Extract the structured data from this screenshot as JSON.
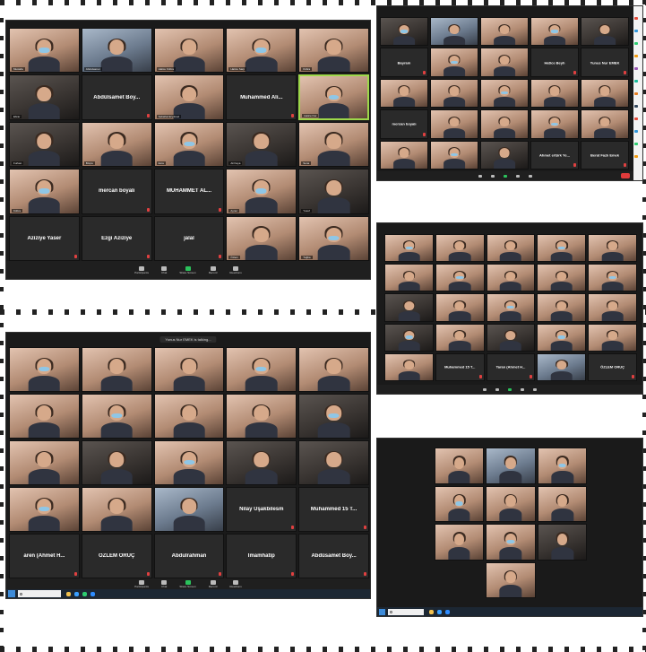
{
  "screenshots": {
    "top_left": {
      "tiles": [
        {
          "kind": "video",
          "tone": "warm",
          "name": "Mustafa"
        },
        {
          "kind": "video",
          "tone": "cool",
          "name": "Abdulsamet"
        },
        {
          "kind": "video",
          "tone": "warm",
          "name": "Hatice Kübra"
        },
        {
          "kind": "video",
          "tone": "warm",
          "name": "Hatice Sarp"
        },
        {
          "kind": "video",
          "tone": "warm",
          "name": "Kübra"
        },
        {
          "kind": "video",
          "tone": "dark",
          "name": "Ebrar"
        },
        {
          "kind": "label",
          "label": "Abdülsamet Boy..."
        },
        {
          "kind": "video",
          "tone": "warm",
          "name": "Sebahat Eryılmaz"
        },
        {
          "kind": "label",
          "label": "Muhammed Ali..."
        },
        {
          "kind": "video",
          "tone": "warm",
          "name": "Hatice Nur",
          "active": true
        },
        {
          "kind": "video",
          "tone": "dark",
          "name": "Furkan"
        },
        {
          "kind": "video",
          "tone": "warm",
          "name": "Büşra"
        },
        {
          "kind": "video",
          "tone": "warm",
          "name": "Esra"
        },
        {
          "kind": "video",
          "tone": "dark",
          "name": "Ali Kaya"
        },
        {
          "kind": "video",
          "tone": "warm",
          "name": "Sena"
        },
        {
          "kind": "video",
          "tone": "warm",
          "name": "Kübra"
        },
        {
          "kind": "label",
          "label": "mercan boyalı"
        },
        {
          "kind": "label",
          "label": "MUHAMMET AL..."
        },
        {
          "kind": "video",
          "tone": "warm",
          "name": "Aynur"
        },
        {
          "kind": "video",
          "tone": "dark",
          "name": "Yusuf"
        },
        {
          "kind": "label",
          "label": "Aziziye Yaser"
        },
        {
          "kind": "label",
          "label": "Ezgi Aziziye"
        },
        {
          "kind": "label",
          "label": "jalal"
        },
        {
          "kind": "video",
          "tone": "warm",
          "name": "Özlem"
        },
        {
          "kind": "video",
          "tone": "warm",
          "name": "Tuğba"
        }
      ],
      "toolbar": [
        "Participants",
        "Chat",
        "Share Screen",
        "Record",
        "Reactions"
      ]
    },
    "top_right": {
      "tiles": [
        {
          "kind": "video",
          "tone": "dark",
          "name": ""
        },
        {
          "kind": "video",
          "tone": "cool",
          "name": ""
        },
        {
          "kind": "video",
          "tone": "warm",
          "name": ""
        },
        {
          "kind": "video",
          "tone": "warm",
          "name": ""
        },
        {
          "kind": "video",
          "tone": "dark",
          "name": ""
        },
        {
          "kind": "label",
          "label": "Bayram"
        },
        {
          "kind": "video",
          "tone": "warm",
          "name": ""
        },
        {
          "kind": "video",
          "tone": "warm",
          "name": ""
        },
        {
          "kind": "label",
          "label": "Hatice Beyh"
        },
        {
          "kind": "label",
          "label": "Yunus Nur EMEK"
        },
        {
          "kind": "video",
          "tone": "warm",
          "name": ""
        },
        {
          "kind": "video",
          "tone": "warm",
          "name": ""
        },
        {
          "kind": "video",
          "tone": "warm",
          "name": ""
        },
        {
          "kind": "video",
          "tone": "warm",
          "name": ""
        },
        {
          "kind": "video",
          "tone": "warm",
          "name": ""
        },
        {
          "kind": "label",
          "label": "mercan boyalı"
        },
        {
          "kind": "video",
          "tone": "warm",
          "name": ""
        },
        {
          "kind": "video",
          "tone": "warm",
          "name": ""
        },
        {
          "kind": "video",
          "tone": "warm",
          "name": ""
        },
        {
          "kind": "video",
          "tone": "warm",
          "name": ""
        },
        {
          "kind": "video",
          "tone": "warm",
          "name": ""
        },
        {
          "kind": "video",
          "tone": "warm",
          "name": ""
        },
        {
          "kind": "video",
          "tone": "dark",
          "name": ""
        },
        {
          "kind": "label",
          "label": "Ahmet ertürk Ye..."
        },
        {
          "kind": "label",
          "label": "Berat Fazlı Emek"
        }
      ]
    },
    "middle_right": {
      "talking": "",
      "tiles": [
        {
          "kind": "video",
          "tone": "warm"
        },
        {
          "kind": "video",
          "tone": "warm"
        },
        {
          "kind": "video",
          "tone": "warm"
        },
        {
          "kind": "video",
          "tone": "warm"
        },
        {
          "kind": "video",
          "tone": "warm"
        },
        {
          "kind": "video",
          "tone": "warm"
        },
        {
          "kind": "video",
          "tone": "warm"
        },
        {
          "kind": "video",
          "tone": "warm"
        },
        {
          "kind": "video",
          "tone": "warm"
        },
        {
          "kind": "video",
          "tone": "warm"
        },
        {
          "kind": "video",
          "tone": "dark"
        },
        {
          "kind": "video",
          "tone": "warm"
        },
        {
          "kind": "video",
          "tone": "warm"
        },
        {
          "kind": "video",
          "tone": "warm"
        },
        {
          "kind": "video",
          "tone": "warm"
        },
        {
          "kind": "video",
          "tone": "dark"
        },
        {
          "kind": "video",
          "tone": "warm"
        },
        {
          "kind": "video",
          "tone": "dark"
        },
        {
          "kind": "video",
          "tone": "warm"
        },
        {
          "kind": "video",
          "tone": "warm"
        },
        {
          "kind": "video",
          "tone": "warm"
        },
        {
          "kind": "label",
          "label": "Muhammed 15 T..."
        },
        {
          "kind": "label",
          "label": "Taran (Ahmet H..."
        },
        {
          "kind": "video",
          "tone": "cool"
        },
        {
          "kind": "label",
          "label": "ÖZLEM ORUÇ"
        }
      ]
    },
    "bottom_left": {
      "talking": "Yunus Nur EMEK is talking...",
      "tiles": [
        {
          "kind": "video",
          "tone": "warm",
          "name": ""
        },
        {
          "kind": "video",
          "tone": "warm",
          "name": ""
        },
        {
          "kind": "video",
          "tone": "warm",
          "name": ""
        },
        {
          "kind": "video",
          "tone": "warm",
          "name": ""
        },
        {
          "kind": "video",
          "tone": "warm",
          "name": ""
        },
        {
          "kind": "video",
          "tone": "warm",
          "name": ""
        },
        {
          "kind": "video",
          "tone": "warm",
          "name": ""
        },
        {
          "kind": "video",
          "tone": "warm",
          "name": ""
        },
        {
          "kind": "video",
          "tone": "warm",
          "name": ""
        },
        {
          "kind": "video",
          "tone": "dark",
          "name": ""
        },
        {
          "kind": "video",
          "tone": "warm",
          "name": ""
        },
        {
          "kind": "video",
          "tone": "dark",
          "name": ""
        },
        {
          "kind": "video",
          "tone": "warm",
          "name": ""
        },
        {
          "kind": "video",
          "tone": "dark",
          "name": ""
        },
        {
          "kind": "video",
          "tone": "dark",
          "name": ""
        },
        {
          "kind": "video",
          "tone": "warm",
          "name": ""
        },
        {
          "kind": "video",
          "tone": "warm",
          "name": ""
        },
        {
          "kind": "video",
          "tone": "cool",
          "name": ""
        },
        {
          "kind": "label",
          "label": "Nilay Uşakbilesm"
        },
        {
          "kind": "label",
          "label": "Muhammed 15 T..."
        },
        {
          "kind": "label",
          "label": "aren (Ahmet H..."
        },
        {
          "kind": "label",
          "label": "ÖZLEM ORUÇ"
        },
        {
          "kind": "label",
          "label": "Abdulrahman"
        },
        {
          "kind": "label",
          "label": "İmamhatip"
        },
        {
          "kind": "label",
          "label": "Abdüsamet Boy..."
        }
      ],
      "toolbar": [
        "Participants",
        "Chat",
        "Share Screen",
        "Record",
        "Reactions"
      ]
    },
    "bottom_right": {
      "tiles": [
        {
          "kind": "empty"
        },
        {
          "kind": "video",
          "tone": "warm"
        },
        {
          "kind": "video",
          "tone": "cool"
        },
        {
          "kind": "video",
          "tone": "warm"
        },
        {
          "kind": "empty"
        },
        {
          "kind": "empty"
        },
        {
          "kind": "video",
          "tone": "warm"
        },
        {
          "kind": "video",
          "tone": "warm"
        },
        {
          "kind": "video",
          "tone": "warm"
        },
        {
          "kind": "empty"
        },
        {
          "kind": "empty"
        },
        {
          "kind": "video",
          "tone": "warm"
        },
        {
          "kind": "video",
          "tone": "warm"
        },
        {
          "kind": "video",
          "tone": "dark"
        },
        {
          "kind": "empty"
        },
        {
          "kind": "empty"
        },
        {
          "kind": "empty"
        },
        {
          "kind": "video",
          "tone": "warm"
        },
        {
          "kind": "empty"
        },
        {
          "kind": "empty"
        }
      ]
    }
  },
  "colors": {
    "zoom_bg": "#1a1a1a",
    "tile_bg": "#2a2a2a",
    "active_speaker": "#9dd84a",
    "end_button": "#e03b3b",
    "share_screen": "#2bc25c",
    "taskbar": "#1c2733"
  },
  "icons": [
    "participants-icon",
    "chat-icon",
    "share-screen-icon",
    "record-icon",
    "reactions-icon",
    "windows-start-icon",
    "search-icon"
  ]
}
